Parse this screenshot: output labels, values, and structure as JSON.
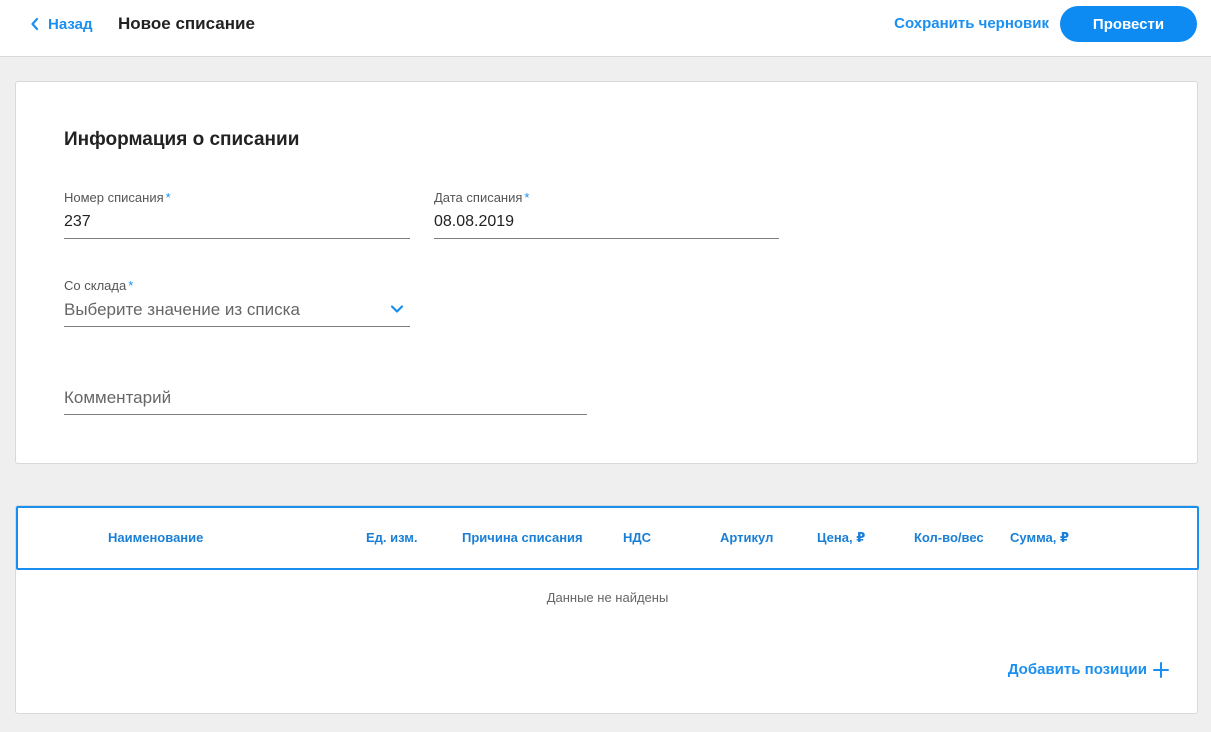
{
  "header": {
    "back_label": "Назад",
    "title": "Новое списание",
    "save_draft_label": "Сохранить черновик",
    "submit_label": "Провести"
  },
  "info": {
    "section_title": "Информация о списании",
    "number": {
      "label": "Номер списания",
      "required_mark": "*",
      "value": "237"
    },
    "date": {
      "label": "Дата списания",
      "required_mark": "*",
      "value": "08.08.2019"
    },
    "warehouse": {
      "label": "Со склада",
      "required_mark": "*",
      "placeholder": "Выберите значение из списка"
    },
    "comment": {
      "placeholder": "Комментарий"
    }
  },
  "table": {
    "columns": [
      "Наименование",
      "Ед. изм.",
      "Причина списания",
      "НДС",
      "Артикул",
      "Цена, ₽",
      "Кол-во/вес",
      "Сумма, ₽"
    ],
    "empty_message": "Данные не найдены",
    "add_label": "Добавить позиции"
  },
  "colors": {
    "accent": "#1a8ff0",
    "primary_button": "#0d8bf2",
    "background": "#efefef"
  },
  "icons": {
    "back": "chevron-left-icon",
    "select": "chevron-down-icon",
    "add": "plus-icon"
  }
}
